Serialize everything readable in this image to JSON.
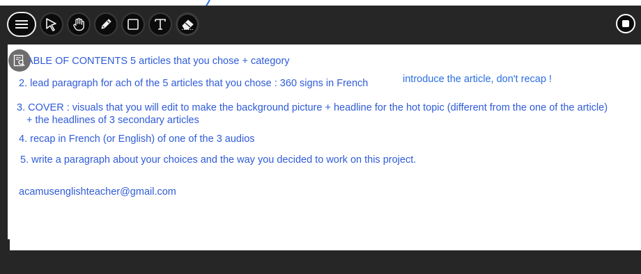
{
  "toolbar": {
    "tools": [
      {
        "id": "menu",
        "icon": "menu-icon"
      },
      {
        "id": "select",
        "icon": "cursor-arrow-icon"
      },
      {
        "id": "pan",
        "icon": "hand-icon"
      },
      {
        "id": "pen",
        "icon": "pencil-icon"
      },
      {
        "id": "shape",
        "icon": "rectangle-icon"
      },
      {
        "id": "text",
        "icon": "text-icon"
      },
      {
        "id": "eraser",
        "icon": "eraser-icon"
      }
    ],
    "active_tool": "eraser",
    "record_icon": "record-stop-icon"
  },
  "document": {
    "lines": {
      "toc": "ABLE OF CONTENTS 5 articles that you chose + category",
      "lead": "2. lead paragraph for ach of the 5 articles that you chose : 360 signs in French",
      "lead_note": "introduce the article, don't recap !",
      "cover_1": "3. COVER : visuals that you will edit to make the background picture + headline for the hot topic (different from the one of the article)",
      "cover_2": "+ the headlines of 3 secondary articles",
      "recap": "4. recap in French (or English) of one of the 3 audios",
      "paragraph": "5. write a paragraph about your choices and the way you decided to work on this project.",
      "email": "acamusenglishteacher@gmail.com"
    },
    "zoom_icon": "zoom-page-icon"
  },
  "colors": {
    "toolbar_bg": "#262626",
    "text_blue": "#2f5bd8",
    "note_blue": "#2a6ee0"
  }
}
